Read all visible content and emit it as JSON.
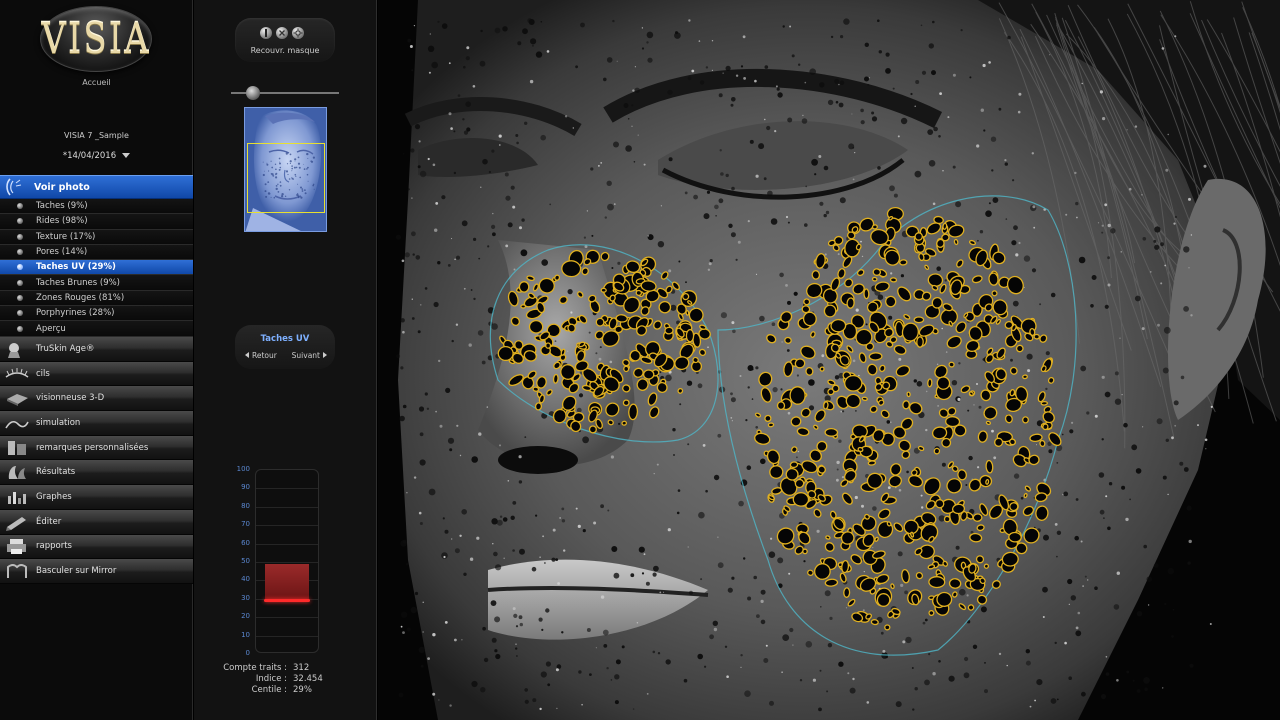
{
  "app": {
    "logo_text": "VISIA",
    "home_label": "Accueil"
  },
  "patient": {
    "name": "VISIA 7 _Sample",
    "session_date": "*14/04/2016"
  },
  "nav": {
    "voir_photo": "Voir photo",
    "analysis_items": [
      {
        "label": "Taches (9%)",
        "active": false
      },
      {
        "label": "Rides (98%)",
        "active": false
      },
      {
        "label": "Texture (17%)",
        "active": false
      },
      {
        "label": "Pores (14%)",
        "active": false
      },
      {
        "label": "Taches UV (29%)",
        "active": true
      },
      {
        "label": "Taches Brunes (9%)",
        "active": false
      },
      {
        "label": "Zones Rouges (81%)",
        "active": false
      },
      {
        "label": "Porphyrines (28%)",
        "active": false
      },
      {
        "label": "Aperçu",
        "active": false
      }
    ],
    "sections": [
      {
        "label": "TruSkin Age®",
        "icon": "head-profile-icon"
      },
      {
        "label": "cils",
        "icon": "eyelash-icon"
      },
      {
        "label": "visionneuse 3-D",
        "icon": "cube-3d-icon"
      },
      {
        "label": "simulation",
        "icon": "simulation-icon"
      },
      {
        "label": "remarques personnalisées",
        "icon": "notes-icon"
      },
      {
        "label": "Résultats",
        "icon": "results-icon"
      },
      {
        "label": "Graphes",
        "icon": "graph-icon"
      },
      {
        "label": "Éditer",
        "icon": "edit-icon"
      },
      {
        "label": "rapports",
        "icon": "printer-icon"
      },
      {
        "label": "Basculer sur Mirror",
        "icon": "mirror-icon"
      }
    ]
  },
  "panel": {
    "mask_label": "Recouvr. masque",
    "mask_icons": [
      "mask-show-icon",
      "mask-clear-icon",
      "mask-settings-icon"
    ],
    "zoom_slider_level": 0.2,
    "analysis_title": "Taches UV",
    "back_label": "Retour",
    "next_label": "Suivant"
  },
  "gauge": {
    "ticks": [
      "100",
      "90",
      "80",
      "70",
      "60",
      "50",
      "40",
      "30",
      "20",
      "10",
      "0"
    ],
    "percentile_value": 29,
    "range_top": 49,
    "range_bottom": 29
  },
  "stats": [
    {
      "label": "Compte traits :",
      "value": "312"
    },
    {
      "label": "Indice :",
      "value": "32.454"
    },
    {
      "label": "Centile :",
      "value": "29%"
    }
  ],
  "colors": {
    "accent_blue": "#1f5cc4",
    "gauge_red": "#ff2a2a",
    "spot_outline": "#e0b020",
    "roi_outline": "#4fb6c8"
  }
}
